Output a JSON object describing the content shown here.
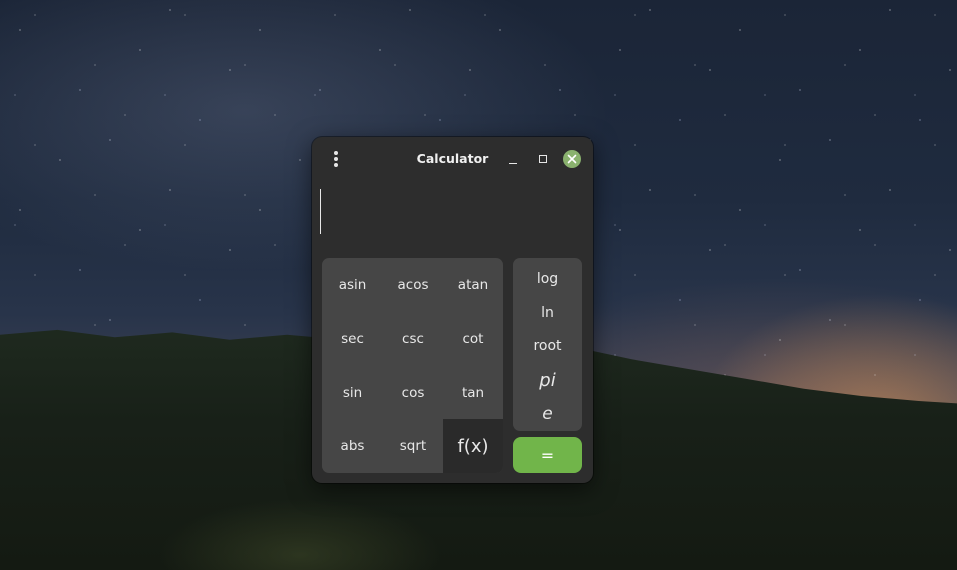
{
  "window": {
    "title": "Calculator"
  },
  "display": {
    "value": ""
  },
  "keypad": {
    "rows": [
      [
        "asin",
        "acos",
        "atan"
      ],
      [
        "sec",
        "csc",
        "cot"
      ],
      [
        "sin",
        "cos",
        "tan"
      ],
      [
        "abs",
        "sqrt",
        "f(x)"
      ]
    ]
  },
  "side_keys": [
    "log",
    "ln",
    "root",
    "pi",
    "e"
  ],
  "equals_label": "=",
  "colors": {
    "accent": "#71b54a",
    "close_button": "#8ab26e",
    "window_bg": "#2d2d2d",
    "panel_bg": "#464646"
  },
  "icons": {
    "menu": "vertical-dots-icon",
    "minimize": "minimize-icon",
    "maximize": "maximize-icon",
    "close": "close-icon"
  }
}
